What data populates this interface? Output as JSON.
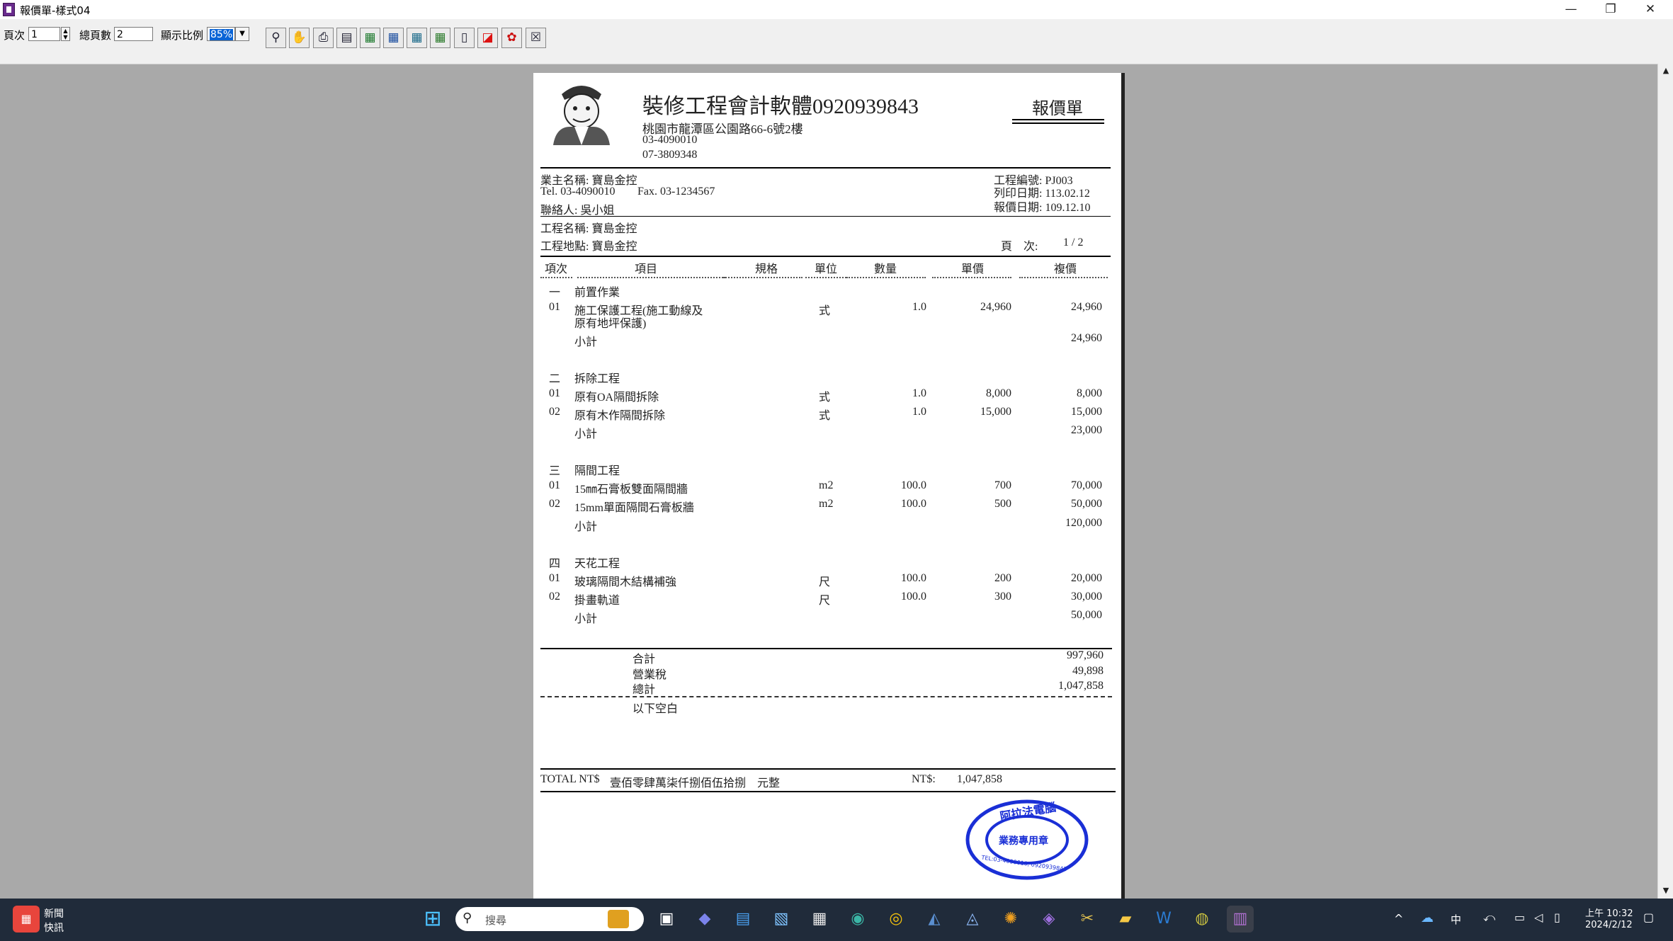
{
  "window": {
    "title": "報價單-樣式04",
    "min": "—",
    "max": "❐",
    "close": "✕"
  },
  "toolbar": {
    "page_label": "頁次",
    "page_value": "1",
    "total_label": "總頁數",
    "total_value": "2",
    "zoom_label": "顯示比例",
    "zoom_value": "85%",
    "icons": [
      "search-icon",
      "hand-icon",
      "print-icon",
      "page-icon",
      "export-excel-icon",
      "export-word-icon",
      "export-image-icon",
      "export-rtf-icon",
      "book-icon",
      "pdf-icon",
      "gift-icon",
      "close-icon"
    ]
  },
  "report": {
    "company": "裝修工程會計軟體0920939843",
    "address": "桃園市龍潭區公園路66-6號2樓",
    "phone1": "03-4090010",
    "phone2": "07-3809348",
    "doc_title": "報價單",
    "client": "業主名稱: 寶島金控",
    "tel": "Tel. 03-4090010",
    "fax": "Fax. 03-1234567",
    "contact": "聯絡人: 吳小姐",
    "project_no": "工程編號: PJ003",
    "print_date": "列印日期: 113.02.12",
    "quote_date": "報價日期: 109.12.10",
    "project_name": "工程名稱: 寶島金控",
    "project_site": "工程地點: 寶島金控",
    "page_label": "頁　次:",
    "page_info": "1  /  2",
    "columns": [
      "項次",
      "項目",
      "規格",
      "單位",
      "數量",
      "單價",
      "複價"
    ],
    "sections": [
      {
        "no": "一",
        "name": "前置作業",
        "items": [
          {
            "no": "01",
            "name": "施工保護工程(施工動線及",
            "name2": "原有地坪保護)",
            "unit": "式",
            "qty": "1.0",
            "price": "24,960",
            "total": "24,960"
          }
        ],
        "subtotal_label": "小計",
        "subtotal": "24,960"
      },
      {
        "no": "二",
        "name": "拆除工程",
        "items": [
          {
            "no": "01",
            "name": "原有OA隔間拆除",
            "name2": "",
            "unit": "式",
            "qty": "1.0",
            "price": "8,000",
            "total": "8,000"
          },
          {
            "no": "02",
            "name": "原有木作隔間拆除",
            "name2": "",
            "unit": "式",
            "qty": "1.0",
            "price": "15,000",
            "total": "15,000"
          }
        ],
        "subtotal_label": "小計",
        "subtotal": "23,000"
      },
      {
        "no": "三",
        "name": "隔間工程",
        "items": [
          {
            "no": "01",
            "name": "15㎜石膏板雙面隔間牆",
            "name2": "",
            "unit": "m2",
            "qty": "100.0",
            "price": "700",
            "total": "70,000"
          },
          {
            "no": "02",
            "name": "15mm單面隔間石膏板牆",
            "name2": "",
            "unit": "m2",
            "qty": "100.0",
            "price": "500",
            "total": "50,000"
          }
        ],
        "subtotal_label": "小計",
        "subtotal": "120,000"
      },
      {
        "no": "四",
        "name": "天花工程",
        "items": [
          {
            "no": "01",
            "name": "玻璃隔間木結構補強",
            "name2": "",
            "unit": "尺",
            "qty": "100.0",
            "price": "200",
            "total": "20,000"
          },
          {
            "no": "02",
            "name": "掛畫軌道",
            "name2": "",
            "unit": "尺",
            "qty": "100.0",
            "price": "300",
            "total": "30,000"
          }
        ],
        "subtotal_label": "小計",
        "subtotal": "50,000"
      }
    ],
    "sum_label": "合計",
    "sum": "997,960",
    "tax_label": "營業稅",
    "tax": "49,898",
    "grand_label": "總計",
    "grand": "1,047,858",
    "blank_note": "以下空白",
    "total_ntd_label": "TOTAL NT$",
    "total_words": "壹佰零肆萬柒仟捌佰伍拾捌　元整",
    "nt_label": "NT$:",
    "nt_value": "1,047,858",
    "stamp_top": "阿拉法電腦",
    "stamp_mid": "業務專用章",
    "stamp_bottom": "TEL:03-4090010, 0920939843"
  },
  "taskbar": {
    "news_line1": "新聞",
    "news_line2": "快訊",
    "search_placeholder": "搜尋",
    "ime": "中",
    "time": "上午 10:32",
    "date": "2024/2/12"
  }
}
